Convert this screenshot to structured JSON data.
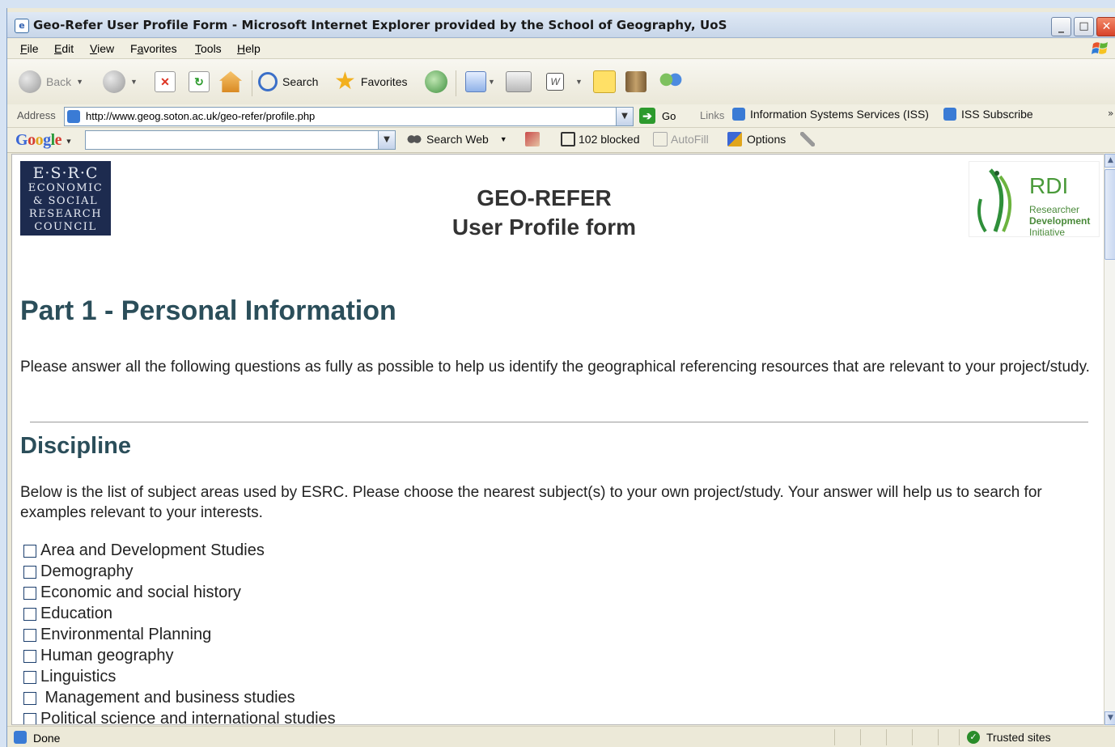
{
  "window": {
    "title": "Geo-Refer User Profile Form - Microsoft Internet Explorer provided by the School of Geography, UoS",
    "minimize": "_",
    "maximize": "□",
    "close": "✕"
  },
  "menu": {
    "items": [
      {
        "key": "F",
        "rest": "ile"
      },
      {
        "key": "E",
        "rest": "dit"
      },
      {
        "key": "V",
        "rest": "iew"
      },
      {
        "pre": "F",
        "key": "a",
        "rest": "vorites"
      },
      {
        "key": "T",
        "rest": "ools"
      },
      {
        "key": "H",
        "rest": "elp"
      }
    ]
  },
  "toolbar": {
    "back": "Back",
    "search": "Search",
    "favorites": "Favorites"
  },
  "address": {
    "label": "Address",
    "url": "http://www.geog.soton.ac.uk/geo-refer/profile.php",
    "go": "Go",
    "links_label": "Links",
    "links": [
      "Information Systems Services (ISS)",
      "ISS Subscribe"
    ]
  },
  "google": {
    "logo": [
      "G",
      "o",
      "o",
      "g",
      "l",
      "e"
    ],
    "logo_colors": [
      "#3b67d6",
      "#d63b2f",
      "#e0a51c",
      "#3b67d6",
      "#2a9a3a",
      "#d63b2f"
    ],
    "search_value": "",
    "search_web": "Search Web",
    "blocked": "102 blocked",
    "autofill": "AutoFill",
    "options": "Options"
  },
  "page": {
    "esrc_logo": {
      "line1": "E·S·R·C",
      "line2": "ECONOMIC",
      "line3": "& SOCIAL",
      "line4": "RESEARCH",
      "line5": "COUNCIL"
    },
    "title_line1": "GEO-REFER",
    "title_line2": "User Profile form",
    "rdi_logo": {
      "big": "RDI",
      "line1": "Researcher",
      "line2": "Development",
      "line3": "Initiative"
    },
    "heading": "Part 1 - Personal Information",
    "intro": "Please answer all the following questions as fully as possible to help us identify the geographical referencing resources that are relevant to your project/study.",
    "discipline_heading": "Discipline",
    "discipline_intro": "Below is the list of subject areas used by ESRC. Please choose the nearest subject(s) to your own project/study. Your answer will help us to search for examples relevant to your interests.",
    "disciplines": [
      "Area and Development Studies",
      "Demography",
      "Economic and social history",
      "Education",
      "Environmental Planning",
      "Human geography",
      "Linguistics",
      " Management and business studies",
      "Political science and international studies"
    ]
  },
  "status": {
    "text": "Done",
    "zone": "Trusted sites"
  }
}
